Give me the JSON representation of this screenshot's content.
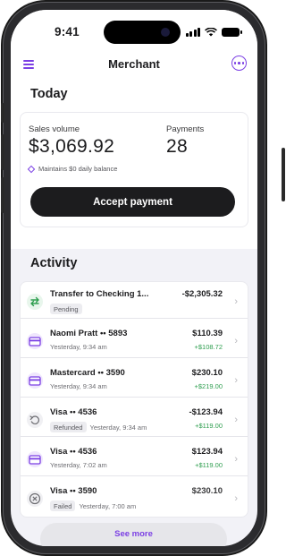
{
  "status": {
    "time": "9:41"
  },
  "nav": {
    "title": "Merchant"
  },
  "today": {
    "heading": "Today",
    "sales_label": "Sales volume",
    "sales_value": "$3,069.92",
    "payments_label": "Payments",
    "payments_value": "28",
    "balance_note": "Maintains $0 daily balance",
    "accept_label": "Accept payment"
  },
  "activity": {
    "heading": "Activity",
    "rows": [
      {
        "icon": "transfer-icon",
        "name": "Transfer to Checking 1...",
        "tag": "Pending",
        "sub": "",
        "amount": "-$2,305.32",
        "amount2": ""
      },
      {
        "icon": "card-icon",
        "name": "Naomi Pratt •• 5893",
        "tag": "",
        "sub": "Yesterday, 9:34 am",
        "amount": "$110.39",
        "amount2": "+$108.72"
      },
      {
        "icon": "card-icon",
        "name": "Mastercard •• 3590",
        "tag": "",
        "sub": "Yesterday, 9:34 am",
        "amount": "$230.10",
        "amount2": "+$219.00"
      },
      {
        "icon": "refund-icon",
        "name": "Visa •• 4536",
        "tag": "Refunded",
        "sub": "Yesterday, 9:34 am",
        "amount": "-$123.94",
        "amount2": "+$119.00"
      },
      {
        "icon": "card-icon",
        "name": "Visa •• 4536",
        "tag": "",
        "sub": "Yesterday, 7:02 am",
        "amount": "$123.94",
        "amount2": "+$119.00"
      },
      {
        "icon": "failed-icon",
        "name": "Visa •• 3590",
        "tag": "Failed",
        "sub": "Yesterday, 7:00 am",
        "amount": "$230.10",
        "amount2": ""
      }
    ]
  },
  "see_more_label": "See more",
  "colors": {
    "accent": "#7b3fe4",
    "positive": "#2e9e4f",
    "transfer": "#2e9e4f"
  }
}
